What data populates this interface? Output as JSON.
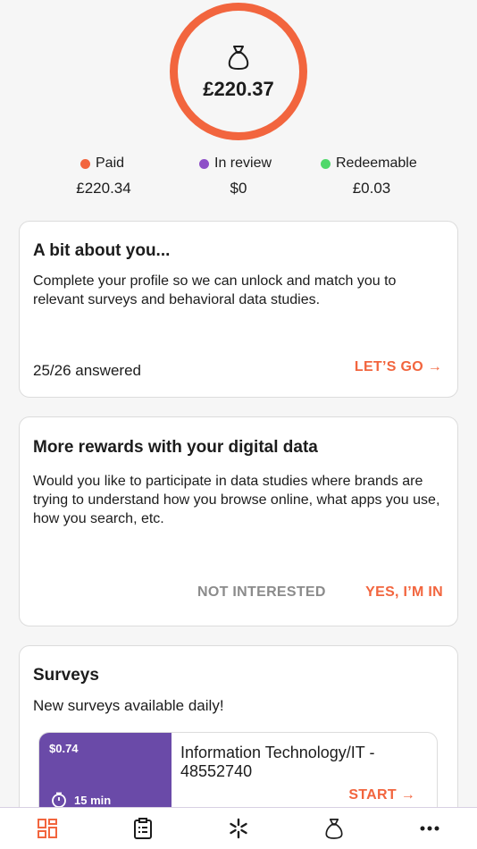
{
  "balance": {
    "amount": "£220.37",
    "icon": "money-bag-icon"
  },
  "breakdown": [
    {
      "label": "Paid",
      "value": "£220.34",
      "color": "#f2653e"
    },
    {
      "label": "In review",
      "value": "$0",
      "color": "#8e4fc8"
    },
    {
      "label": "Redeemable",
      "value": "£0.03",
      "color": "#4fd86a"
    }
  ],
  "profile_card": {
    "title": "A bit about you...",
    "text": "Complete your profile so we can unlock and match you to relevant surveys and behavioral data studies.",
    "progress": "25/26 answered",
    "action": "LET’S GO →"
  },
  "data_card": {
    "title": "More rewards with your digital data",
    "text": "Would you like to participate in data studies where brands are trying to understand how you browse online, what apps you use, how you search, etc.",
    "decline": "NOT INTERESTED",
    "accept": "YES, I’M IN"
  },
  "surveys_card": {
    "title": "Surveys",
    "subtitle": "New surveys available daily!",
    "items": [
      {
        "price": "$0.74",
        "duration": "15 min",
        "title": "Information Technology/IT - 48552740",
        "action": "START →"
      }
    ]
  },
  "nav": [
    "dashboard-icon",
    "surveys-clipboard-icon",
    "data-studies-icon",
    "rewards-bag-icon",
    "more-icon"
  ],
  "colors": {
    "accent": "#f2653e",
    "survey_purple": "#6a4aa8"
  }
}
